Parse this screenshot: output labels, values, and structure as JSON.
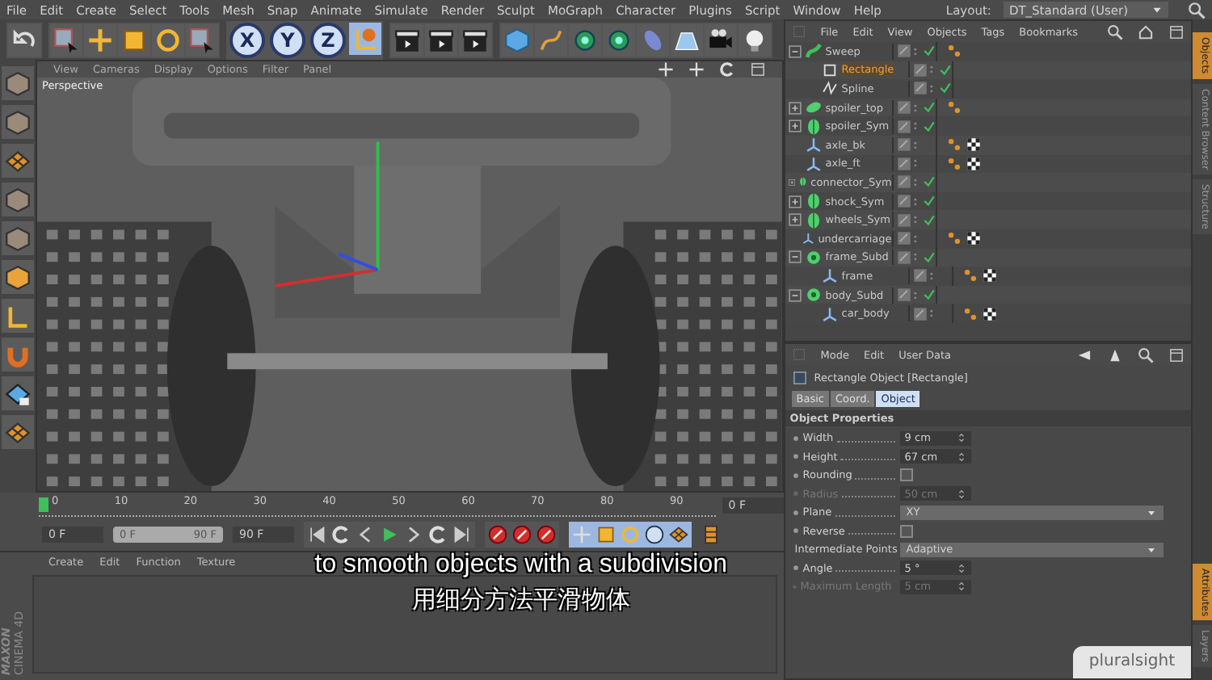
{
  "menu_bar": [
    "File",
    "Edit",
    "Create",
    "Select",
    "Tools",
    "Mesh",
    "Snap",
    "Animate",
    "Simulate",
    "Render",
    "Sculpt",
    "MoGraph",
    "Character",
    "Plugins",
    "Script",
    "Window",
    "Help"
  ],
  "layout": {
    "label": "Layout:",
    "value": "DT_Standard (User)"
  },
  "axis_buttons": [
    {
      "label": "X",
      "on": true
    },
    {
      "label": "Y",
      "on": true
    },
    {
      "label": "Z",
      "on": true
    }
  ],
  "viewport": {
    "menu": [
      "View",
      "Cameras",
      "Display",
      "Options",
      "Filter",
      "Panel"
    ],
    "camera": "Perspective"
  },
  "timeline": {
    "ticks": [
      "0",
      "10",
      "20",
      "30",
      "40",
      "50",
      "60",
      "70",
      "80",
      "90"
    ],
    "playhead": {
      "level": 0
    },
    "current_frame": "0 F"
  },
  "playback": {
    "start": "0 F",
    "range": {
      "start": "0 F",
      "end": "90 F",
      "level": 1
    },
    "end": "90 F"
  },
  "materials": {
    "menu": [
      "Create",
      "Edit",
      "Function",
      "Texture"
    ]
  },
  "brand": {
    "line1": "MAXON",
    "line2": "CINEMA 4D"
  },
  "object_manager": {
    "menu": [
      "File",
      "Edit",
      "View",
      "Objects",
      "Tags",
      "Bookmarks"
    ],
    "objects": [
      {
        "name": "Sweep",
        "kind": "sweep",
        "selected": false,
        "expanded": true,
        "enabled": true,
        "phong_tag": true,
        "material_tag": false,
        "children": [
          {
            "name": "Rectangle",
            "kind": "rectangle",
            "selected": true,
            "enabled": true,
            "phong_tag": false,
            "material_tag": false
          },
          {
            "name": "Spline",
            "kind": "spline",
            "selected": false,
            "enabled": true,
            "phong_tag": false,
            "material_tag": false
          }
        ]
      },
      {
        "name": "spoiler_top",
        "kind": "extrude",
        "selected": false,
        "expanded": false,
        "enabled": true,
        "phong_tag": true,
        "material_tag": false
      },
      {
        "name": "spoiler_Sym",
        "kind": "symmetry",
        "selected": false,
        "expanded": false,
        "enabled": true,
        "phong_tag": false,
        "material_tag": false
      },
      {
        "name": "axle_bk",
        "kind": "null",
        "selected": false,
        "enabled": false,
        "phong_tag": true,
        "material_tag": true
      },
      {
        "name": "axle_ft",
        "kind": "null",
        "selected": false,
        "enabled": false,
        "phong_tag": true,
        "material_tag": true
      },
      {
        "name": "connector_Sym",
        "kind": "symmetry",
        "selected": false,
        "expanded": false,
        "enabled": true,
        "phong_tag": false,
        "material_tag": false
      },
      {
        "name": "shock_Sym",
        "kind": "symmetry",
        "selected": false,
        "expanded": false,
        "enabled": true,
        "phong_tag": false,
        "material_tag": false
      },
      {
        "name": "wheels_Sym",
        "kind": "symmetry",
        "selected": false,
        "expanded": false,
        "enabled": true,
        "phong_tag": false,
        "material_tag": false
      },
      {
        "name": "undercarriage",
        "kind": "null",
        "selected": false,
        "enabled": false,
        "phong_tag": true,
        "material_tag": true
      },
      {
        "name": "frame_Subd",
        "kind": "subdivision",
        "selected": false,
        "expanded": true,
        "enabled": true,
        "phong_tag": false,
        "material_tag": false,
        "children": [
          {
            "name": "frame",
            "kind": "null",
            "selected": false,
            "enabled": false,
            "phong_tag": true,
            "material_tag": true
          }
        ]
      },
      {
        "name": "body_Subd",
        "kind": "subdivision",
        "selected": false,
        "expanded": true,
        "enabled": true,
        "phong_tag": false,
        "material_tag": false,
        "children": [
          {
            "name": "car_body",
            "kind": "null",
            "selected": false,
            "enabled": false,
            "phong_tag": true,
            "material_tag": true
          }
        ]
      }
    ]
  },
  "attributes": {
    "menu": [
      "Mode",
      "Edit",
      "User Data"
    ],
    "title": "Rectangle Object [Rectangle]",
    "tabs": [
      {
        "label": "Basic",
        "selected": false
      },
      {
        "label": "Coord.",
        "selected": false
      },
      {
        "label": "Object",
        "selected": true
      }
    ],
    "section": "Object Properties",
    "properties": [
      {
        "kind": "number",
        "label": "Width",
        "value": "9 cm",
        "disabled": false
      },
      {
        "kind": "number",
        "label": "Height",
        "value": "67 cm",
        "disabled": false
      },
      {
        "kind": "checkbox",
        "label": "Rounding",
        "checked": false,
        "disabled": false
      },
      {
        "kind": "number",
        "label": "Radius",
        "value": "50 cm",
        "disabled": true
      },
      {
        "kind": "dropdown",
        "label": "Plane",
        "value": "XY",
        "disabled": false
      },
      {
        "kind": "checkbox",
        "label": "Reverse",
        "checked": false,
        "disabled": false
      },
      {
        "kind": "dropdown",
        "label": "Intermediate Points",
        "value": "Adaptive",
        "disabled": false
      },
      {
        "kind": "number",
        "label": "Angle",
        "value": "5 °",
        "disabled": false
      },
      {
        "kind": "number",
        "label": "Maximum Length",
        "value": "5 cm",
        "disabled": true
      }
    ]
  },
  "side_tabs_top": [
    {
      "label": "Objects",
      "selected": true
    },
    {
      "label": "Content Browser",
      "selected": false
    },
    {
      "label": "Structure",
      "selected": false
    }
  ],
  "side_tabs_bottom": [
    {
      "label": "Attributes",
      "selected": true
    },
    {
      "label": "Layers",
      "selected": false
    }
  ],
  "captions": [
    "to smooth objects with a subdivision",
    "用细分方法平滑物体"
  ],
  "badge": "pluralsight"
}
